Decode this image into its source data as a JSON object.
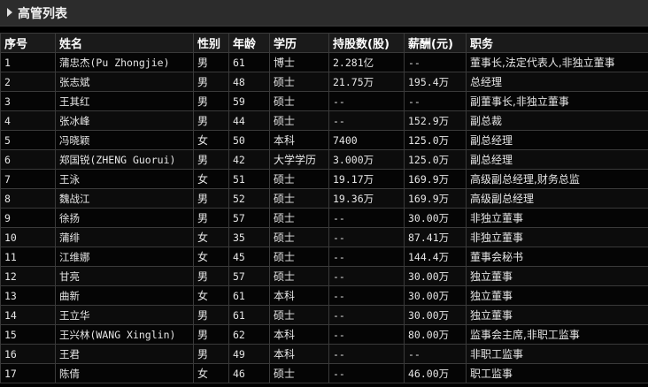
{
  "panel": {
    "title": "高管列表"
  },
  "table": {
    "headers": [
      "序号",
      "姓名",
      "性别",
      "年龄",
      "学历",
      "持股数(股)",
      "薪酬(元)",
      "职务"
    ],
    "rows": [
      [
        "1",
        "蒲忠杰(Pu Zhongjie)",
        "男",
        "61",
        "博士",
        "2.281亿",
        "--",
        "董事长,法定代表人,非独立董事"
      ],
      [
        "2",
        "张志斌",
        "男",
        "48",
        "硕士",
        "21.75万",
        "195.4万",
        "总经理"
      ],
      [
        "3",
        "王其红",
        "男",
        "59",
        "硕士",
        "--",
        "--",
        "副董事长,非独立董事"
      ],
      [
        "4",
        "张冰峰",
        "男",
        "44",
        "硕士",
        "--",
        "152.9万",
        "副总裁"
      ],
      [
        "5",
        "冯晓颖",
        "女",
        "50",
        "本科",
        "7400",
        "125.0万",
        "副总经理"
      ],
      [
        "6",
        "郑国锐(ZHENG Guorui)",
        "男",
        "42",
        "大学学历",
        "3.000万",
        "125.0万",
        "副总经理"
      ],
      [
        "7",
        "王泳",
        "女",
        "51",
        "硕士",
        "19.17万",
        "169.9万",
        "高级副总经理,财务总监"
      ],
      [
        "8",
        "魏战江",
        "男",
        "52",
        "硕士",
        "19.36万",
        "169.9万",
        "高级副总经理"
      ],
      [
        "9",
        "徐扬",
        "男",
        "57",
        "硕士",
        "--",
        "30.00万",
        "非独立董事"
      ],
      [
        "10",
        "蒲绯",
        "女",
        "35",
        "硕士",
        "--",
        "87.41万",
        "非独立董事"
      ],
      [
        "11",
        "江维娜",
        "女",
        "45",
        "硕士",
        "--",
        "144.4万",
        "董事会秘书"
      ],
      [
        "12",
        "甘亮",
        "男",
        "57",
        "硕士",
        "--",
        "30.00万",
        "独立董事"
      ],
      [
        "13",
        "曲新",
        "女",
        "61",
        "本科",
        "--",
        "30.00万",
        "独立董事"
      ],
      [
        "14",
        "王立华",
        "男",
        "61",
        "硕士",
        "--",
        "30.00万",
        "独立董事"
      ],
      [
        "15",
        "王兴林(WANG Xinglin)",
        "男",
        "62",
        "本科",
        "--",
        "80.00万",
        "监事会主席,非职工监事"
      ],
      [
        "16",
        "王君",
        "男",
        "49",
        "本科",
        "--",
        "--",
        "非职工监事"
      ],
      [
        "17",
        "陈倩",
        "女",
        "46",
        "硕士",
        "--",
        "46.00万",
        "职工监事"
      ]
    ]
  }
}
